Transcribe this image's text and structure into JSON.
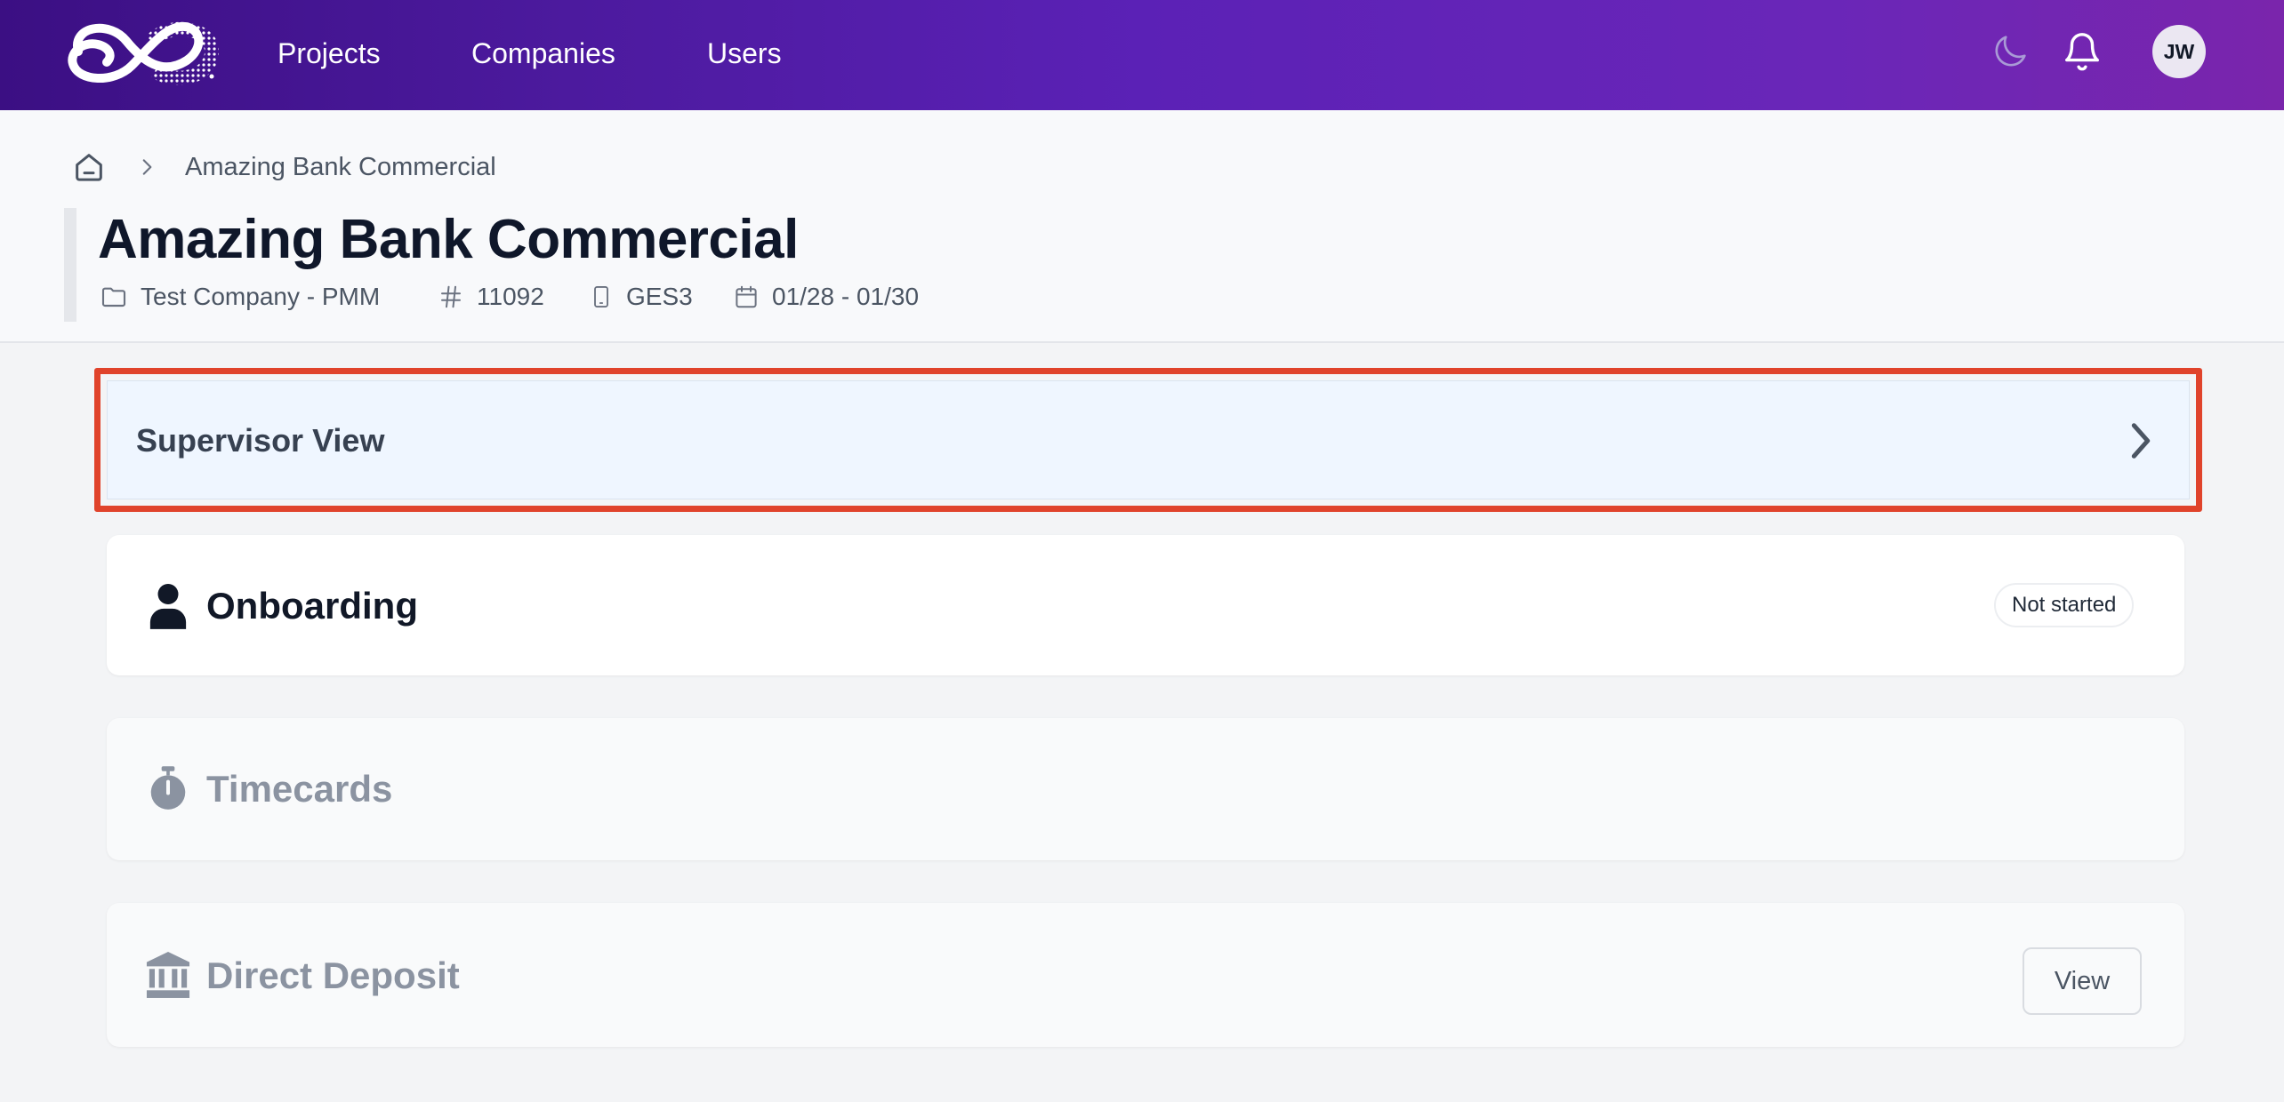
{
  "nav": {
    "links": [
      "Projects",
      "Companies",
      "Users"
    ],
    "avatar_initials": "JW",
    "icons": [
      "logo-icon",
      "moon-icon",
      "bell-icon"
    ]
  },
  "breadcrumb": {
    "current": "Amazing Bank Commercial"
  },
  "project": {
    "title": "Amazing Bank Commercial",
    "company": "Test Company - PMM",
    "number": "11092",
    "device": "GES3",
    "dates": "01/28 - 01/30"
  },
  "sections": {
    "supervisor": {
      "label": "Supervisor View",
      "highlight_color": "#e0432b"
    },
    "onboarding": {
      "title": "Onboarding",
      "status": "Not started"
    },
    "timecards": {
      "title": "Timecards"
    },
    "deposit": {
      "title": "Direct Deposit",
      "button": "View"
    }
  },
  "colors": {
    "nav_gradient_start": "#3b0f83",
    "nav_gradient_end": "#7a25ac",
    "highlight": "#e0432b",
    "supervisor_bg": "#eff6ff",
    "disabled_text": "#8b93a1"
  }
}
